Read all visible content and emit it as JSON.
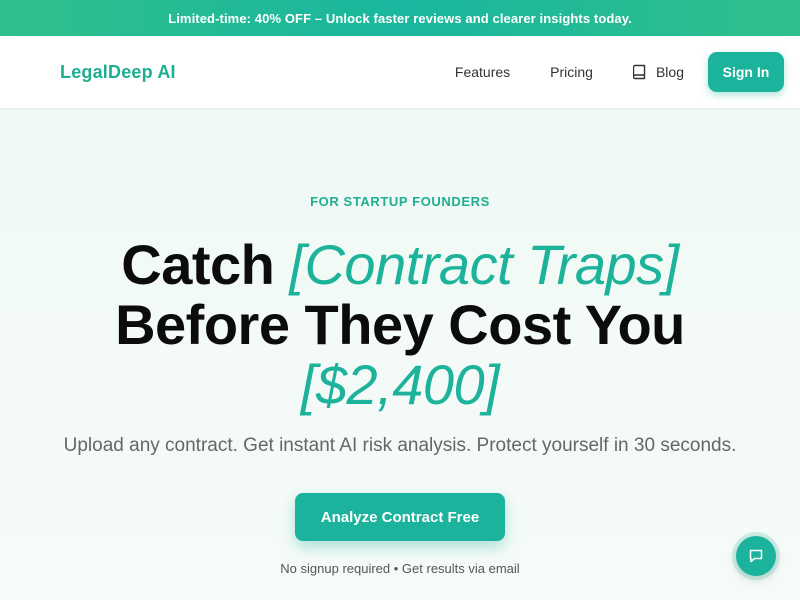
{
  "promo": {
    "text": "Limited-time: 40% OFF – Unlock faster reviews and clearer insights today."
  },
  "nav": {
    "logo": "LegalDeep AI",
    "links": {
      "features": "Features",
      "pricing": "Pricing",
      "blog": "Blog"
    },
    "signin": "Sign In"
  },
  "hero": {
    "eyebrow": "FOR STARTUP FOUNDERS",
    "headline": {
      "part1": "Catch ",
      "accent1": "[Contract Traps]",
      "part2": "Before They Cost You",
      "accent2": "[$2,400]"
    },
    "subhead": "Upload any contract. Get instant AI risk analysis. Protect yourself in 30 seconds.",
    "cta": "Analyze Contract Free",
    "note": "No signup required • Get results via email"
  },
  "icons": {
    "blog": "book-icon",
    "chat": "chat-bubble-icon"
  },
  "colors": {
    "brand": "#1bb39b",
    "promo": "#2fbf8c",
    "text": "#0c0c0c"
  }
}
